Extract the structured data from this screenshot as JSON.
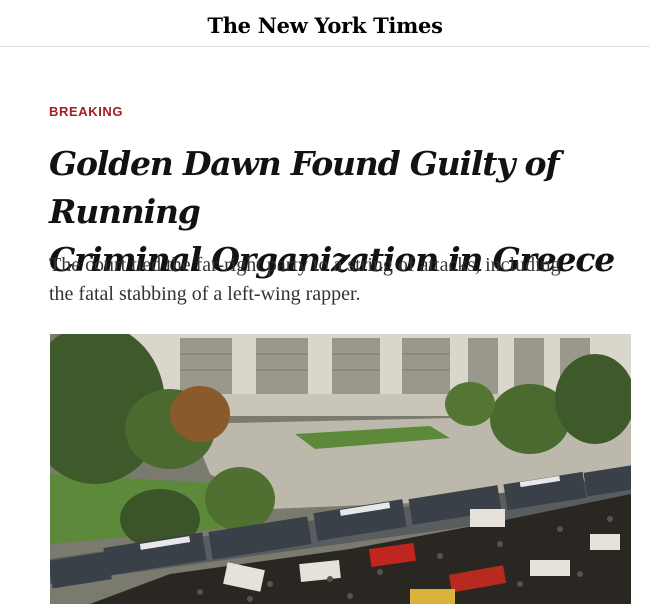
{
  "header": {
    "logo_text": "The New York Times"
  },
  "article": {
    "kicker": "BREAKING",
    "headline_line1": "Golden Dawn Found Guilty of Running",
    "headline_line2": "Criminal Organization in Greece",
    "summary_line1": "The court tied the far-right party to a string of attacks, including",
    "summary_line2": "the fatal stabbing of a left-wing rapper."
  },
  "photo": {
    "subject": "aerial-view-courthouse-crowd-protest",
    "colors": {
      "sky_building": "#d9d6cc",
      "trees": "#3f5a2a",
      "lawn": "#5c8a3a",
      "crowd": "#2a2622",
      "banner_red": "#c0261f",
      "bus": "#394048"
    }
  }
}
